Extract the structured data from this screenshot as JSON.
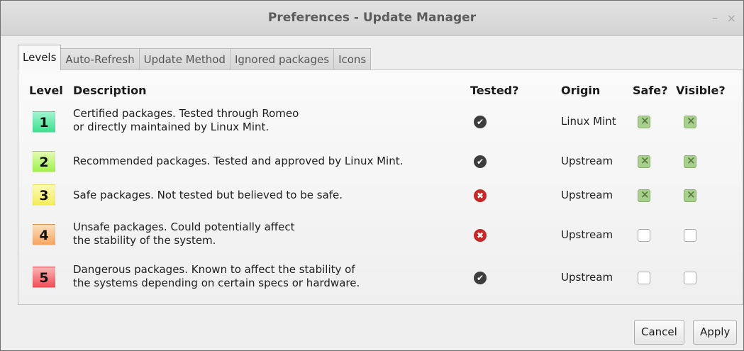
{
  "window": {
    "title": "Preferences - Update Manager",
    "minimize_glyph": "–",
    "close_glyph": "×"
  },
  "tabs": [
    {
      "label": "Levels",
      "active": true
    },
    {
      "label": "Auto-Refresh",
      "active": false
    },
    {
      "label": "Update Method",
      "active": false
    },
    {
      "label": "Ignored packages",
      "active": false
    },
    {
      "label": "Icons",
      "active": false
    }
  ],
  "table": {
    "headers": {
      "level": "Level",
      "description": "Description",
      "tested": "Tested?",
      "origin": "Origin",
      "safe": "Safe?",
      "visible": "Visible?"
    },
    "rows": [
      {
        "level": "1",
        "color_top": "#9ff5cf",
        "color_bottom": "#3fe08f",
        "description_line1": "Certified packages. Tested through Romeo",
        "description_line2": "or directly maintained by Linux Mint.",
        "tested": "check-circle-icon",
        "origin": "Linux Mint",
        "safe": true,
        "visible": true
      },
      {
        "level": "2",
        "color_top": "#e4fbb2",
        "color_bottom": "#9ef24b",
        "description_line1": "Recommended packages. Tested and approved by Linux Mint.",
        "description_line2": "",
        "tested": "check-circle-icon",
        "origin": "Upstream",
        "safe": true,
        "visible": true
      },
      {
        "level": "3",
        "color_top": "#fdfab5",
        "color_bottom": "#f4ec5c",
        "description_line1": "Safe packages. Not tested but believed to be safe.",
        "description_line2": "",
        "tested": "cross-circle-icon",
        "origin": "Upstream",
        "safe": true,
        "visible": true
      },
      {
        "level": "4",
        "color_top": "#fde0bd",
        "color_bottom": "#f5a45e",
        "description_line1": "Unsafe packages. Could potentially affect",
        "description_line2": "the stability of the system.",
        "tested": "cross-circle-icon",
        "origin": "Upstream",
        "safe": false,
        "visible": false
      },
      {
        "level": "5",
        "color_top": "#fbb5b5",
        "color_bottom": "#ee4d55",
        "description_line1": "Dangerous packages. Known to affect the stability of",
        "description_line2": "the systems depending on certain specs or hardware.",
        "tested": "check-circle-icon",
        "origin": "Upstream",
        "safe": false,
        "visible": false
      }
    ]
  },
  "buttons": {
    "cancel": "Cancel",
    "apply": "Apply"
  },
  "colors": {
    "check_icon": "#3d3d3d",
    "cross_icon": "#c62828",
    "checkbox_checked": "#a8d08c"
  }
}
